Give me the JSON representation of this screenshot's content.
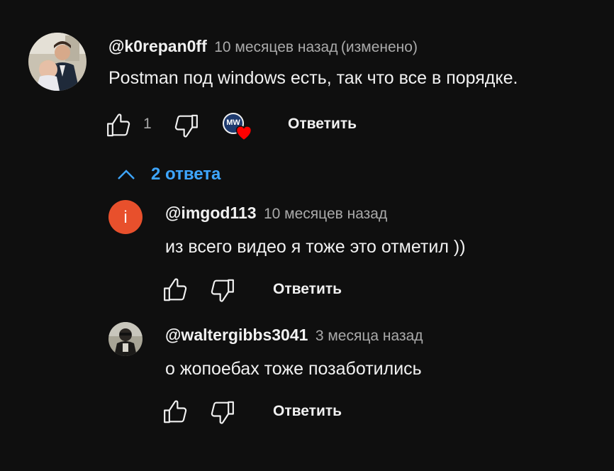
{
  "comment": {
    "author": "@k0repan0ff",
    "time": "10 месяцев назад",
    "edited": "(изменено)",
    "text": "Postman под windows есть, так что все в порядке.",
    "like_count": "1",
    "reply_label": "Ответить",
    "creator_heart": "MW",
    "replies_toggle": "2 ответа"
  },
  "replies": [
    {
      "author": "@imgod113",
      "time": "10 месяцев назад",
      "text": "из всего видео я тоже это отметил ))",
      "avatar_letter": "i",
      "avatar_color": "#e8502c",
      "reply_label": "Ответить"
    },
    {
      "author": "@waltergibbs3041",
      "time": "3 месяца назад",
      "text": "о жопоебах тоже позаботились",
      "reply_label": "Ответить"
    }
  ],
  "colors": {
    "background": "#0f0f0f",
    "link": "#3ea6ff",
    "heart": "#ff0000"
  }
}
